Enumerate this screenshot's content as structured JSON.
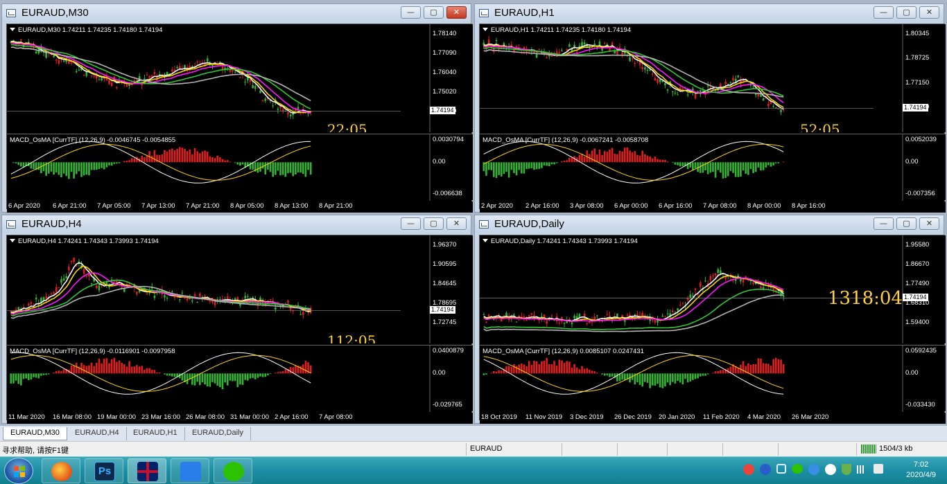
{
  "windows": [
    {
      "title": "EURAUD,M30",
      "legend": "EURAUD,M30  1.74211 1.74235 1.74180 1.74194",
      "price_labels": [
        "1.78140",
        "1.77090",
        "1.76040",
        "1.75020",
        "1.73970"
      ],
      "current_price": "1.74194",
      "timer": "22:05",
      "macd_legend": "MACD_OsMA [CurrTF] (12,26,9) -0.0046745 -0.0054855",
      "macd_labels": [
        "0.0030794",
        "0.00",
        "-0.006638"
      ],
      "time_labels": [
        "6 Apr 2020",
        "6 Apr 21:00",
        "7 Apr 05:00",
        "7 Apr 13:00",
        "7 Apr 21:00",
        "8 Apr 05:00",
        "8 Apr 13:00",
        "8 Apr 21:00"
      ]
    },
    {
      "title": "EURAUD,H1",
      "legend": "EURAUD,H1  1.74211 1.74235 1.74180 1.74194",
      "price_labels": [
        "1.80345",
        "1.78725",
        "1.77150",
        "1.75530"
      ],
      "current_price": "1.74194",
      "timer": "52:05",
      "macd_legend": "MACD_OsMA [CurrTF] (12,26,9) -0.0067241 -0.0058708",
      "macd_labels": [
        "0.0052039",
        "0.00",
        "-0.007356"
      ],
      "time_labels": [
        "2 Apr 2020",
        "2 Apr 16:00",
        "3 Apr 08:00",
        "6 Apr 00:00",
        "6 Apr 16:00",
        "7 Apr 08:00",
        "8 Apr 00:00",
        "8 Apr 16:00"
      ]
    },
    {
      "title": "EURAUD,H4",
      "legend": "EURAUD,H4  1.74241 1.74343 1.73993 1.74194",
      "price_labels": [
        "1.96370",
        "1.90595",
        "1.84645",
        "1.78695",
        "1.72745"
      ],
      "current_price": "1.74194",
      "timer": "112:05",
      "macd_legend": "MACD_OsMA [CurrTF] (12,26,9) -0.0116901 -0.0097958",
      "macd_labels": [
        "0.0400879",
        "0.00",
        "-0.029765"
      ],
      "time_labels": [
        "11 Mar 2020",
        "16 Mar 08:00",
        "19 Mar 00:00",
        "23 Mar 16:00",
        "26 Mar 08:00",
        "31 Mar 00:00",
        "2 Apr 16:00",
        "7 Apr 08:00"
      ]
    },
    {
      "title": "EURAUD,Daily",
      "legend": "EURAUD,Daily  1.74241 1.74343 1.73993 1.74194",
      "price_labels": [
        "1.95580",
        "1.86670",
        "1.77490",
        "1.68310",
        "1.59400"
      ],
      "current_price": "1.74194",
      "timer": "1318:04",
      "macd_legend": "MACD_OsMA [CurrTF] (12,26,9) 0.0085107 0.0247431",
      "macd_labels": [
        "0.0592435",
        "0.00",
        "-0.033430"
      ],
      "time_labels": [
        "18 Oct 2019",
        "11 Nov 2019",
        "3 Dec 2019",
        "26 Dec 2019",
        "20 Jan 2020",
        "11 Feb 2020",
        "4 Mar 2020",
        "26 Mar 2020"
      ]
    }
  ],
  "window_buttons": {
    "minimize": "—",
    "maximize": "▢",
    "close": "✕"
  },
  "tabs": [
    "EURAUD,M30",
    "EURAUD,H4",
    "EURAUD,H1",
    "EURAUD,Daily"
  ],
  "status": {
    "help": "寻求帮助, 请按F1键",
    "profile": "EURAUD",
    "traffic": "1504/3 kb"
  },
  "clock": {
    "time": "7:02",
    "date": "2020/4/9"
  },
  "colors": {
    "candle_up": "#32b432",
    "candle_down": "#dc1e1e",
    "ma_fast": "#ffffff",
    "ma_yellow": "#ffd700",
    "ma_magenta": "#ff14ff",
    "ma_green": "#32c832",
    "ma_gray": "#b4b4b4",
    "timer": "#ffd23c",
    "taskbar": "#1c8ea3"
  },
  "taskbar_apps": [
    "firefox-icon",
    "photoshop-icon",
    "flag-icon",
    "notes-icon",
    "wechat-icon"
  ],
  "tray_icons": [
    "sogou-icon",
    "help-icon",
    "wifi-icon",
    "wechat-icon",
    "chat-icon",
    "security-icon",
    "shield-icon",
    "signal-icon",
    "volume-icon"
  ]
}
